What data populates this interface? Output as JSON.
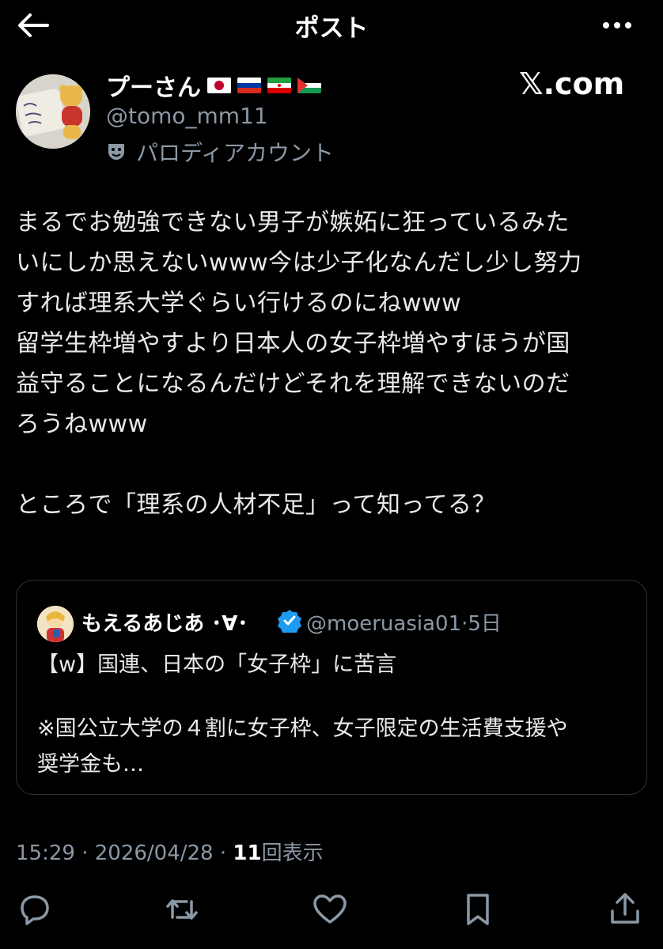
{
  "header": {
    "title": "ポスト"
  },
  "author": {
    "display_name": "プーさん",
    "handle": "@tomo_mm11",
    "account_label": "パロディアカウント"
  },
  "brand": "𝕏.com",
  "post": {
    "lines": [
      "まるでお勉強できない男子が嫉妬に狂っているみた",
      "いにしか思えないwww今は少子化なんだし少し努力",
      "すれば理系大学ぐらい行けるのにねwww",
      "留学生枠増やすより日本人の女子枠増やすほうが国",
      "益守ることになるんだけどそれを理解できないのだ",
      "ろうねwww",
      "",
      "ところで「理系の人材不足」って知ってる？"
    ]
  },
  "quote": {
    "display_name": "もえるあじあ ･∀･",
    "handle": "@moeruasia01",
    "time": "5日",
    "headline": "【w】国連、日本の「女子枠」に苦言",
    "body_lines": [
      "※国公立大学の４割に女子枠、女子限定の生活費支援や",
      "奨学金も…"
    ]
  },
  "meta": {
    "time": "15:29",
    "date": "2026/04/28",
    "views": "11",
    "views_label": "回表示"
  },
  "colors": {
    "background": "#000000",
    "text": "#e7e9ea",
    "secondary": "#8b98a5",
    "border": "#2f3336",
    "verified": "#1d9bf0"
  }
}
